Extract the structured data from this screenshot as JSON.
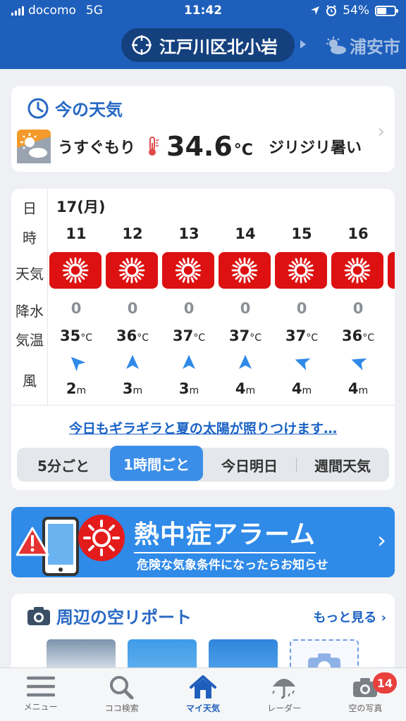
{
  "status_bar": {
    "carrier": "docomo",
    "network": "5G",
    "time": "11:42",
    "battery": "54%",
    "battery_level": 0.54
  },
  "header": {
    "current_location": "江戸川区北小岩",
    "next_location": "浦安市"
  },
  "now": {
    "title": "今の天気",
    "condition": "うすぐもり",
    "temperature": "34.6",
    "unit": "°C",
    "description": "ジリジリ暑い"
  },
  "forecast": {
    "row_labels": {
      "day": "日",
      "hour": "時",
      "weather": "天気",
      "rain": "降水",
      "temp": "気温",
      "wind": "風"
    },
    "date": "17(月)",
    "temp_unit": "°C",
    "wind_unit": "m",
    "hours": [
      {
        "hour": "11",
        "weather": "sunny",
        "rain": "0",
        "temp": "35",
        "wind_dir_deg": 315,
        "wind_speed": "2"
      },
      {
        "hour": "12",
        "weather": "sunny",
        "rain": "0",
        "temp": "36",
        "wind_dir_deg": 0,
        "wind_speed": "3"
      },
      {
        "hour": "13",
        "weather": "sunny",
        "rain": "0",
        "temp": "37",
        "wind_dir_deg": 0,
        "wind_speed": "3"
      },
      {
        "hour": "14",
        "weather": "sunny",
        "rain": "0",
        "temp": "37",
        "wind_dir_deg": 0,
        "wind_speed": "4"
      },
      {
        "hour": "15",
        "weather": "sunny",
        "rain": "0",
        "temp": "37",
        "wind_dir_deg": 290,
        "wind_speed": "4"
      },
      {
        "hour": "16",
        "weather": "sunny",
        "rain": "0",
        "temp": "36",
        "wind_dir_deg": 290,
        "wind_speed": "4"
      }
    ],
    "comment": "今日もギラギラと夏の太陽が照りつけます…",
    "tabs": [
      "5分ごと",
      "1時間ごと",
      "今日明日",
      "週間天気"
    ],
    "active_tab": 1
  },
  "alarm": {
    "title": "熱中症アラーム",
    "subtitle": "危険な気象条件になったらお知らせ"
  },
  "report": {
    "title": "周辺の空リポート",
    "more": "もっと見る"
  },
  "nav": {
    "items": [
      {
        "label": "メニュー",
        "icon": "menu-icon"
      },
      {
        "label": "ココ検索",
        "icon": "search-icon"
      },
      {
        "label": "マイ天気",
        "icon": "home-icon"
      },
      {
        "label": "レーダー",
        "icon": "umbrella-icon"
      },
      {
        "label": "空の写真",
        "icon": "camera-icon"
      }
    ],
    "active": 2,
    "photo_badge": "14"
  },
  "colors": {
    "brand_blue": "#1e5fbb",
    "accent_blue": "#2f8ae8",
    "sunny_red": "#dd1111"
  }
}
